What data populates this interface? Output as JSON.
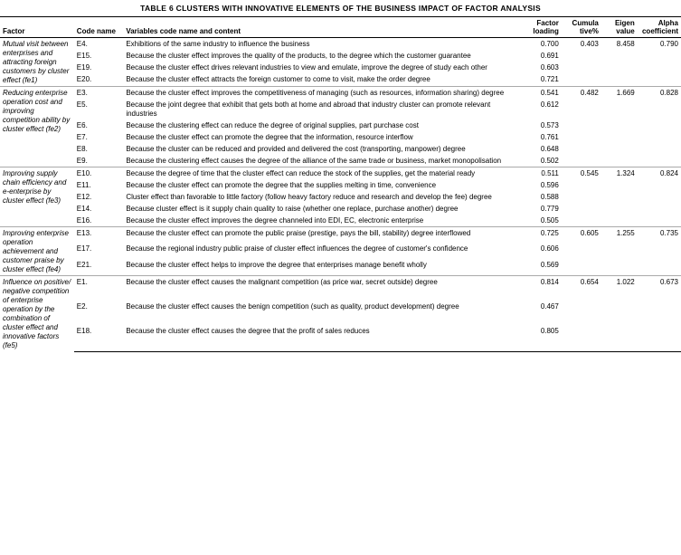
{
  "title": "TABLE 6 CLUSTERS WITH INNOVATIVE ELEMENTS OF THE BUSINESS IMPACT OF FACTOR ANALYSIS",
  "headers": {
    "factor": "Factor",
    "code": "Code name",
    "variables": "Variables code name and content",
    "loading": "Factor loading",
    "cumula": "Cumula tive%",
    "eigen": "Eigen value",
    "alpha": "Alpha coefficient"
  },
  "sections": [
    {
      "factor": "Mutual visit between enterprises and attracting foreign customers by cluster effect (fe1)",
      "rows": [
        {
          "code": "E4.",
          "variables": "Exhibitions of the same industry to influence the business",
          "loading": "0.700",
          "cumula": "0.403",
          "eigen": "8.458",
          "alpha": "0.790"
        },
        {
          "code": "E15.",
          "variables": "Because the cluster effect improves the quality of the products, to the degree which the customer guarantee",
          "loading": "0.691",
          "cumula": "",
          "eigen": "",
          "alpha": ""
        },
        {
          "code": "E19.",
          "variables": "Because the cluster effect drives relevant industries to view and emulate, improve the degree of study each other",
          "loading": "0.603",
          "cumula": "",
          "eigen": "",
          "alpha": ""
        },
        {
          "code": "E20.",
          "variables": "Because the cluster effect attracts the foreign customer to come to visit, make the order degree",
          "loading": "0.721",
          "cumula": "",
          "eigen": "",
          "alpha": ""
        }
      ]
    },
    {
      "factor": "Reducing enterprise operation cost and improving competition ability by cluster effect (fe2)",
      "rows": [
        {
          "code": "E3.",
          "variables": "Because the cluster effect improves the competitiveness of managing (such as resources, information sharing) degree",
          "loading": "0.541",
          "cumula": "0.482",
          "eigen": "1.669",
          "alpha": "0.828"
        },
        {
          "code": "E5.",
          "variables": "Because the joint degree that exhibit that gets both at home and abroad that industry cluster can promote relevant industries",
          "loading": "0.612",
          "cumula": "",
          "eigen": "",
          "alpha": ""
        },
        {
          "code": "E6.",
          "variables": "Because the clustering effect can reduce the degree of original supplies, part purchase cost",
          "loading": "0.573",
          "cumula": "",
          "eigen": "",
          "alpha": ""
        },
        {
          "code": "E7.",
          "variables": "Because the cluster effect can promote the degree that the information, resource interflow",
          "loading": "0.761",
          "cumula": "",
          "eigen": "",
          "alpha": ""
        },
        {
          "code": "E8.",
          "variables": "Because the cluster can be reduced and provided and delivered the cost (transporting, manpower) degree",
          "loading": "0.648",
          "cumula": "",
          "eigen": "",
          "alpha": ""
        },
        {
          "code": "E9.",
          "variables": "Because the clustering effect causes the degree of the alliance of the same trade or business, market monopolisation",
          "loading": "0.502",
          "cumula": "",
          "eigen": "",
          "alpha": ""
        }
      ]
    },
    {
      "factor": "Improving supply chain efficiency and e-enterprise by cluster effect (fe3)",
      "rows": [
        {
          "code": "E10.",
          "variables": "Because the degree of time that the cluster effect can reduce the stock of the supplies, get the material ready",
          "loading": "0.511",
          "cumula": "0.545",
          "eigen": "1.324",
          "alpha": "0.824"
        },
        {
          "code": "E11.",
          "variables": "Because the cluster effect can promote the degree that the supplies melting in time, convenience",
          "loading": "0.596",
          "cumula": "",
          "eigen": "",
          "alpha": ""
        },
        {
          "code": "E12.",
          "variables": "Cluster effect than favorable to little factory (follow heavy factory reduce and research and develop the fee) degree",
          "loading": "0.588",
          "cumula": "",
          "eigen": "",
          "alpha": ""
        },
        {
          "code": "E14.",
          "variables": "Because cluster effect is it supply chain quality to raise (whether one replace, purchase another) degree",
          "loading": "0.779",
          "cumula": "",
          "eigen": "",
          "alpha": ""
        },
        {
          "code": "E16.",
          "variables": "Because the cluster effect improves the degree channeled into EDI, EC, electronic enterprise",
          "loading": "0.505",
          "cumula": "",
          "eigen": "",
          "alpha": ""
        }
      ]
    },
    {
      "factor": "Improving enterprise operation achievement and customer praise by cluster effect (fe4)",
      "rows": [
        {
          "code": "E13.",
          "variables": "Because the cluster effect can promote the public praise (prestige, pays the bill, stability) degree interflowed",
          "loading": "0.725",
          "cumula": "0.605",
          "eigen": "1.255",
          "alpha": "0.735"
        },
        {
          "code": "E17.",
          "variables": "Because the regional industry public praise of cluster effect influences the degree of customer's confidence",
          "loading": "0.606",
          "cumula": "",
          "eigen": "",
          "alpha": ""
        },
        {
          "code": "E21.",
          "variables": "Because the cluster effect helps to improve the degree that enterprises manage benefit wholly",
          "loading": "0.569",
          "cumula": "",
          "eigen": "",
          "alpha": ""
        }
      ]
    },
    {
      "factor": "Influence on positive/ negative competition of enterprise operation by the combination of cluster effect and innovative factors (fe5)",
      "rows": [
        {
          "code": "E1.",
          "variables": "Because the cluster effect causes the malignant competition (as price war, secret outside) degree",
          "loading": "0.814",
          "cumula": "0.654",
          "eigen": "1.022",
          "alpha": "0.673"
        },
        {
          "code": "E2.",
          "variables": "Because the cluster effect causes the benign competition (such as quality, product development) degree",
          "loading": "0.467",
          "cumula": "",
          "eigen": "",
          "alpha": ""
        },
        {
          "code": "E18.",
          "variables": "Because the cluster effect causes the degree that the profit of sales reduces",
          "loading": "0.805",
          "cumula": "",
          "eigen": "",
          "alpha": ""
        }
      ]
    }
  ]
}
